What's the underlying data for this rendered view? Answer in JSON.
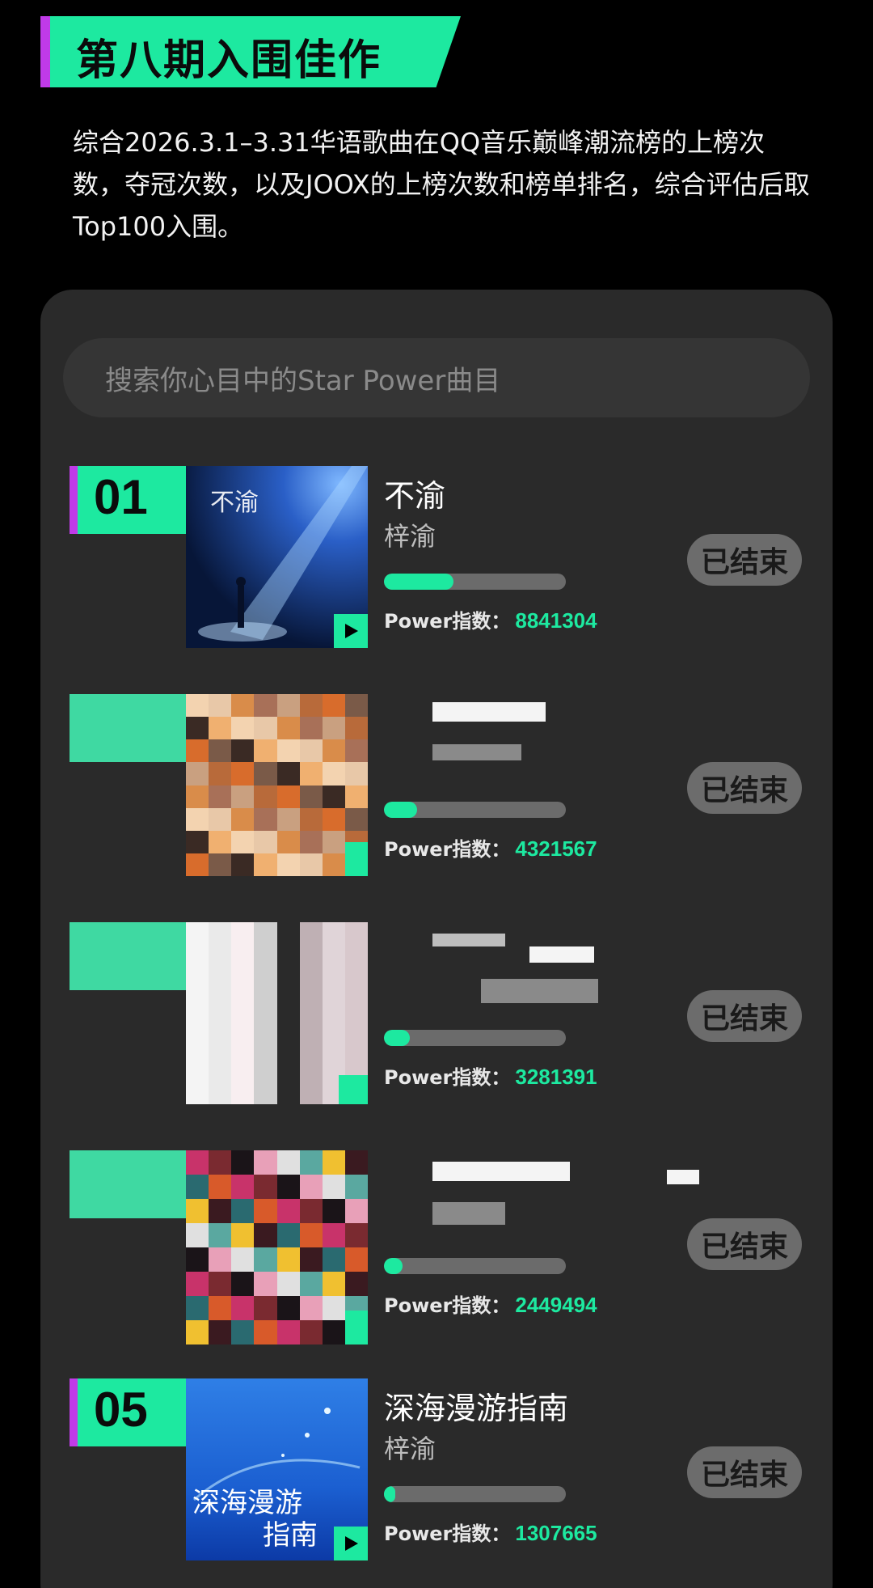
{
  "header": {
    "title": "第八期入围佳作"
  },
  "intro": "综合2026.3.1–3.31华语歌曲在QQ音乐巅峰潮流榜的上榜次数，夺冠次数，以及JOOX的上榜次数和榜单排名，综合评估后取Top100入围。",
  "search": {
    "placeholder": "搜索你心目中的Star Power曲目"
  },
  "power_label": "Power指数：",
  "items": [
    {
      "rank": "01",
      "song": "不渝",
      "artist": "梓渝",
      "power": "8841304",
      "progress": 0.38,
      "status": "已结束"
    },
    {
      "rank": "",
      "song": "",
      "artist": "",
      "power": "4321567",
      "progress": 0.18,
      "status": "已结束"
    },
    {
      "rank": "",
      "song": "",
      "artist": "",
      "power": "3281391",
      "progress": 0.14,
      "status": "已结束"
    },
    {
      "rank": "",
      "song": "",
      "artist": "",
      "power": "2449494",
      "progress": 0.1,
      "status": "已结束"
    },
    {
      "rank": "05",
      "song": "深海漫游指南",
      "artist": "梓渝",
      "power": "1307665",
      "progress": 0.06,
      "status": "已结束"
    }
  ],
  "colors": {
    "accent": "#1de9a0",
    "purple": "#c03ae8",
    "panel": "#2a2a2a"
  }
}
